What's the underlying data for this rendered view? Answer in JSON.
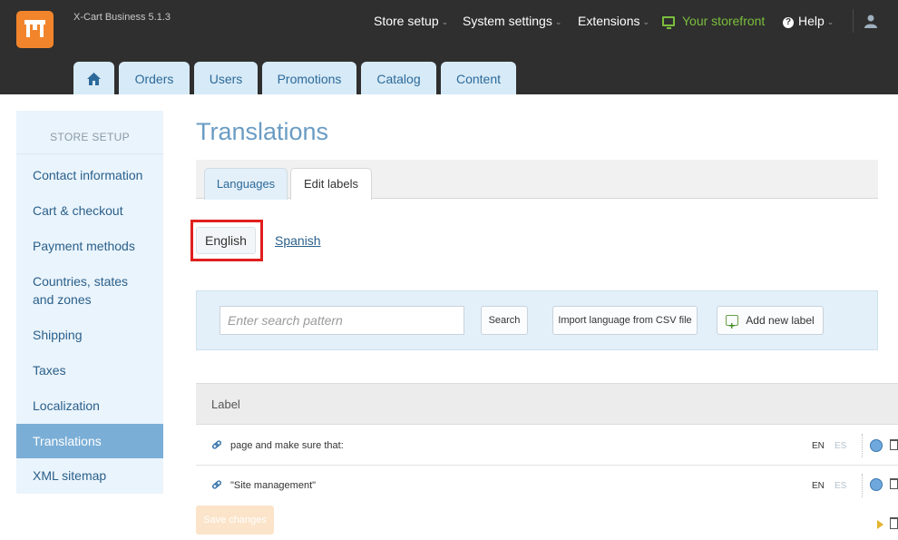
{
  "header": {
    "brand": "X-Cart Business 5.1.3",
    "nav": {
      "store_setup": "Store setup",
      "system_settings": "System settings",
      "extensions": "Extensions",
      "storefront": "Your storefront",
      "help": "Help"
    },
    "tabs": [
      "Orders",
      "Users",
      "Promotions",
      "Catalog",
      "Content"
    ]
  },
  "sidebar": {
    "title": "STORE SETUP",
    "items": [
      "Contact information",
      "Cart & checkout",
      "Payment methods",
      "Countries, states",
      "and zones",
      "Shipping",
      "Taxes",
      "Localization",
      "Translations",
      "XML sitemap"
    ],
    "active": "Translations"
  },
  "main": {
    "title": "Translations",
    "subtabs": [
      "Languages",
      "Edit labels"
    ],
    "languages": {
      "selected": "English",
      "other": "Spanish"
    },
    "search": {
      "placeholder": "Enter search pattern",
      "search_label": "Search",
      "import_label": "Import language from CSV file",
      "add_label": "Add new label"
    },
    "table": {
      "header": "Label",
      "rows": [
        {
          "text": "page and make sure that:",
          "en": "EN",
          "es": "ES"
        },
        {
          "text": "\"Site management\"",
          "en": "EN",
          "es": "ES"
        }
      ]
    },
    "save_label": "Save changes"
  },
  "colors": {
    "accent": "#6a9cc4",
    "sidebar_active": "#7aaed6",
    "highlight_box": "#e01f1f",
    "storefront": "#7bbf3c"
  }
}
